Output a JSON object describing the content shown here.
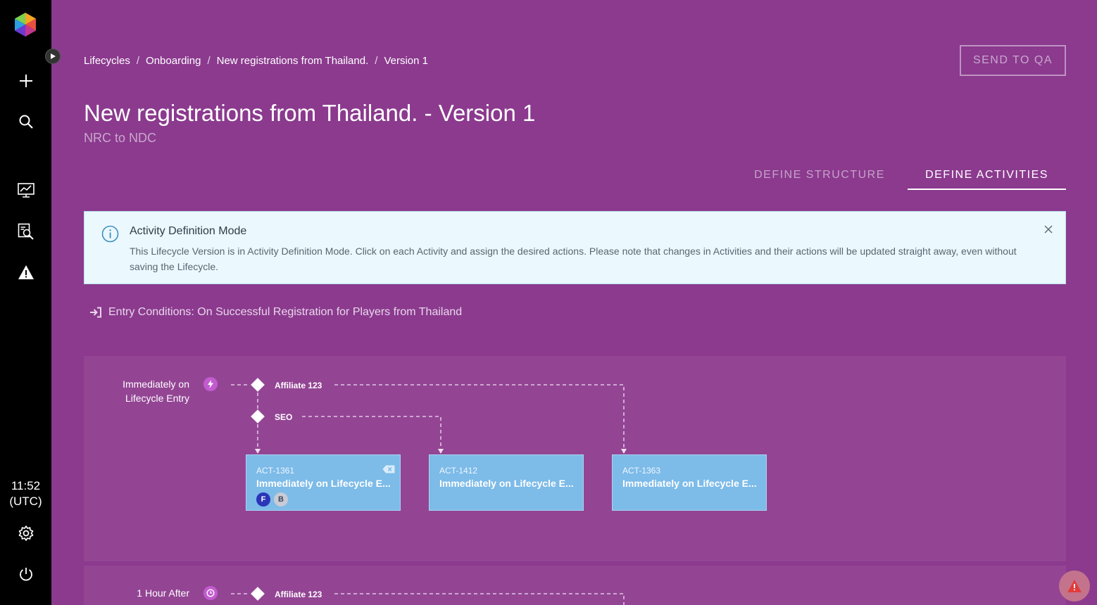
{
  "sidebar": {
    "items": [
      {
        "icon": "plus-icon"
      },
      {
        "icon": "search-icon"
      },
      {
        "icon": "monitor-chart-icon"
      },
      {
        "icon": "report-search-icon"
      },
      {
        "icon": "warning-icon"
      },
      {
        "icon": "gear-icon"
      },
      {
        "icon": "power-icon"
      }
    ],
    "clock_time": "11:52",
    "clock_zone": "(UTC)"
  },
  "breadcrumb": [
    "Lifecycles",
    "Onboarding",
    "New registrations from Thailand.",
    "Version 1"
  ],
  "breadcrumb_sep": "/",
  "header": {
    "send_label": "SEND TO QA",
    "title": "New registrations from Thailand. -  Version 1",
    "subtitle": "NRC to NDC"
  },
  "tabs": {
    "structure": "DEFINE STRUCTURE",
    "activities": "DEFINE ACTIVITIES"
  },
  "info": {
    "title": "Activity Definition Mode",
    "body": "This Lifecycle Version is in Activity Definition Mode. Click on each Activity and assign the desired actions. Please note that changes in Activities and their actions will be updated straight away, even without saving the Lifecycle."
  },
  "entry": {
    "text": "Entry Conditions: On Successful Registration for Players from Thailand"
  },
  "flow": {
    "row1": {
      "label": "Immediately on Lifecycle Entry",
      "node1": "Affiliate 123",
      "node2": "SEO",
      "cards": [
        {
          "id": "ACT-1361",
          "name": "Immediately on Lifecycle E...",
          "avatars": [
            "F",
            "B"
          ]
        },
        {
          "id": "ACT-1412",
          "name": "Immediately on Lifecycle E..."
        },
        {
          "id": "ACT-1363",
          "name": "Immediately on Lifecycle E..."
        }
      ]
    },
    "row2": {
      "label": "1 Hour After",
      "node1": "Affiliate 123"
    }
  },
  "colors": {
    "background": "#8b3a8e",
    "card": "#7dbbe8",
    "info_bg": "#ebf8fd",
    "avatar_f": "#2a36b8",
    "avatar_b": "#c8cbd6"
  }
}
